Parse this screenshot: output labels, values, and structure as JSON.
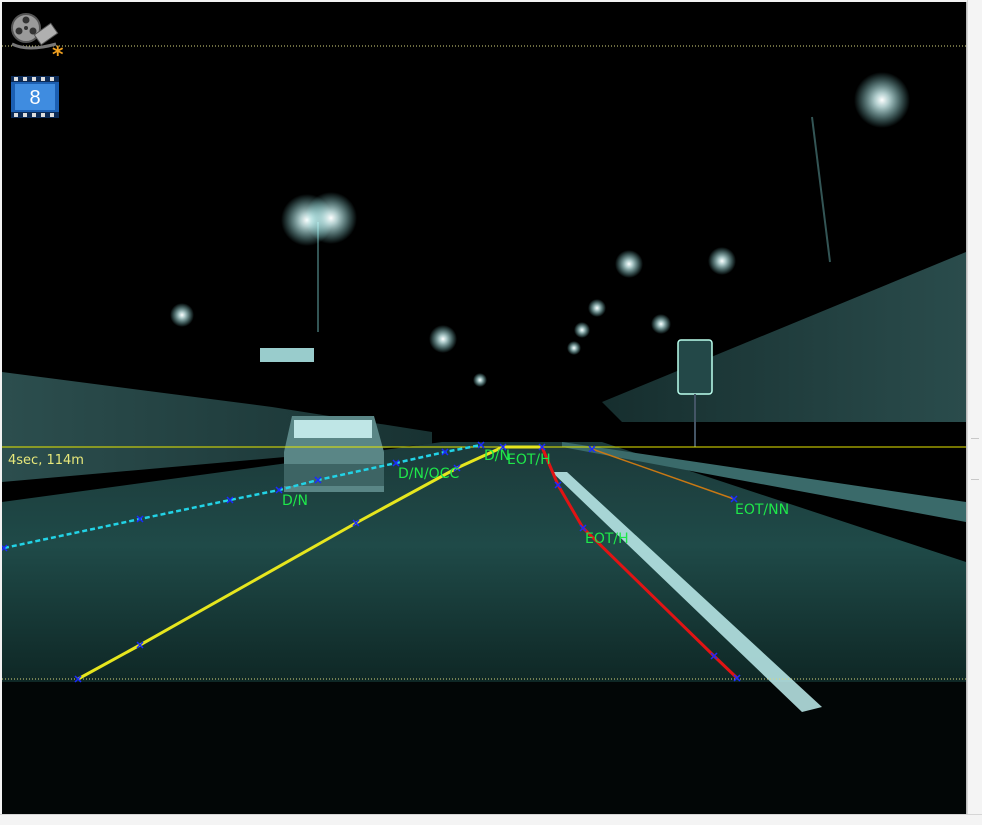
{
  "toolbar": {
    "reel_icon": "film-reel-icon",
    "modified_marker": "*",
    "frame_number": "8"
  },
  "horizon": {
    "caption": "4sec, 114m"
  },
  "lane_labels": [
    {
      "text": "D/N"
    },
    {
      "text": "D/N/OCC"
    },
    {
      "text": "D/N"
    },
    {
      "text": "EOT/H"
    },
    {
      "text": "EOT/H"
    },
    {
      "text": "EOT/NN"
    }
  ],
  "lane_lines": [
    {
      "type": "D/N",
      "color": "#22d3e6",
      "style": "dashed"
    },
    {
      "type": "D/N/OCC",
      "color": "#e6e61e",
      "style": "solid"
    },
    {
      "type": "EOT/H",
      "color": "#e11414",
      "style": "solid"
    },
    {
      "type": "EOT/NN",
      "color": "#c87814",
      "style": "solid"
    }
  ],
  "colors": {
    "label_green": "#1ee84a",
    "horizon_yellow": "#e8e87a",
    "control_point_blue": "#1a2aff"
  }
}
